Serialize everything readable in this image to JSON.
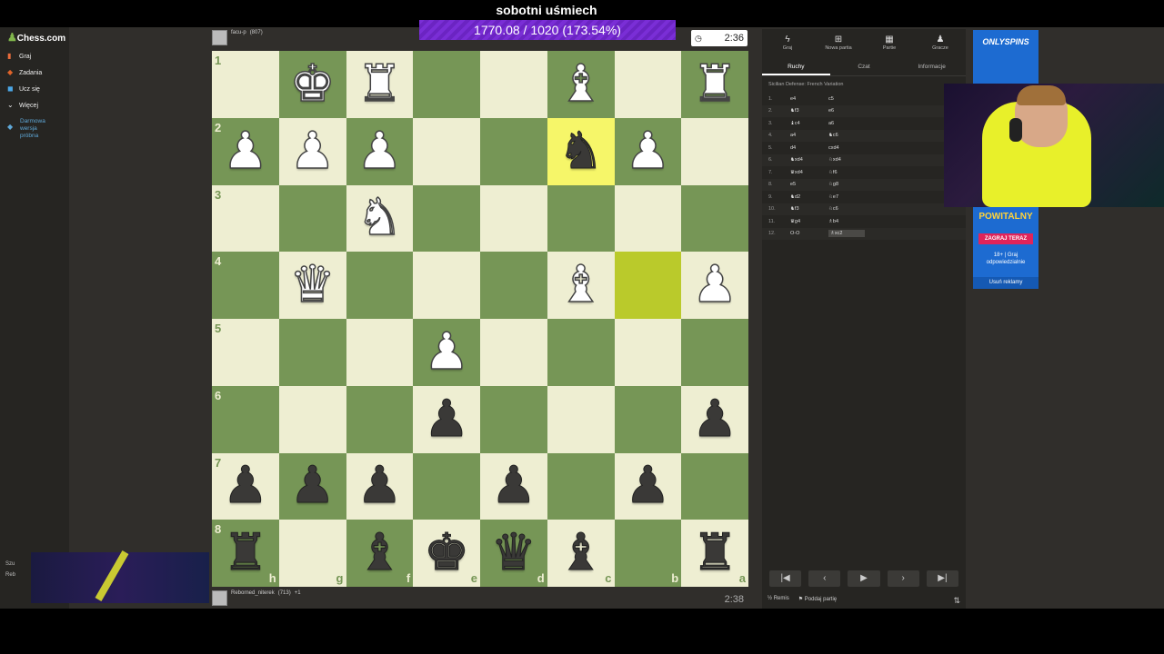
{
  "overlay": {
    "title": "sobotni uśmiech",
    "counter": "1770.08 / 1020 (173.54%)"
  },
  "sidebar": {
    "logo": "Chess.com",
    "items": [
      {
        "label": "Graj",
        "icon": "play-icon"
      },
      {
        "label": "Zadania",
        "icon": "puzzle-icon"
      },
      {
        "label": "Ucz się",
        "icon": "learn-icon"
      },
      {
        "label": "Więcej",
        "icon": "chevron-down-icon"
      }
    ],
    "promo": "Darmowa wersja próbna",
    "search_label": "Szu",
    "user_label": "Reb"
  },
  "top_player": {
    "name": "facu-p",
    "rating": "(807)",
    "clock": "2:36"
  },
  "bottom_player": {
    "name": "Reborned_niterek",
    "rating": "(713)",
    "material": "+1",
    "clock": "2:38"
  },
  "board": {
    "colors": {
      "light": "#eeeed2",
      "dark": "#769656",
      "highlight_light": "#f6f669",
      "highlight_dark": "#baca2b"
    },
    "ranks": [
      "1",
      "2",
      "3",
      "4",
      "5",
      "6",
      "7",
      "8"
    ],
    "files": [
      "h",
      "g",
      "f",
      "e",
      "d",
      "c",
      "b",
      "a"
    ],
    "rows": [
      [
        "",
        "wK",
        "wR",
        "",
        "",
        "wB",
        "",
        "wR"
      ],
      [
        "wP",
        "wP",
        "wP",
        "",
        "",
        "bN",
        "wP",
        ""
      ],
      [
        "",
        "",
        "wN",
        "",
        "",
        "",
        "",
        ""
      ],
      [
        "",
        "wQ",
        "",
        "",
        "",
        "wB",
        "",
        "wP"
      ],
      [
        "",
        "",
        "",
        "wP",
        "",
        "",
        "",
        ""
      ],
      [
        "",
        "",
        "",
        "bP",
        "",
        "",
        "",
        "bP"
      ],
      [
        "bP",
        "bP",
        "bP",
        "",
        "bP",
        "",
        "bP",
        ""
      ],
      [
        "bR",
        "",
        "bB",
        "bK",
        "bQ",
        "bB",
        "",
        "bR"
      ]
    ],
    "highlights": [
      [
        1,
        5
      ],
      [
        3,
        6
      ]
    ]
  },
  "panel": {
    "tabs": [
      {
        "label": "Graj",
        "icon": "lightning-icon"
      },
      {
        "label": "Nowa partia",
        "icon": "plus-icon"
      },
      {
        "label": "Partie",
        "icon": "grid-icon"
      },
      {
        "label": "Gracze",
        "icon": "people-icon"
      }
    ],
    "subtabs": [
      "Ruchy",
      "Czat",
      "Informacje"
    ],
    "opening": "Sicilian Defense: French Variation",
    "moves": [
      {
        "n": "1.",
        "w": "e4",
        "b": "c5"
      },
      {
        "n": "2.",
        "w": "♞f3",
        "b": "e6"
      },
      {
        "n": "3.",
        "w": "♝c4",
        "b": "a6"
      },
      {
        "n": "4.",
        "w": "a4",
        "b": "♞c6"
      },
      {
        "n": "5.",
        "w": "d4",
        "b": "cxd4"
      },
      {
        "n": "6.",
        "w": "♞xd4",
        "b": "♘xd4"
      },
      {
        "n": "7.",
        "w": "♛xd4",
        "b": "♘f6"
      },
      {
        "n": "8.",
        "w": "e5",
        "b": "♘g8"
      },
      {
        "n": "9.",
        "w": "♞d2",
        "b": "♘e7"
      },
      {
        "n": "10.",
        "w": "♞f3",
        "b": "♘c6"
      },
      {
        "n": "11.",
        "w": "♛g4",
        "b": "♗b4"
      },
      {
        "n": "12.",
        "w": "O-O",
        "b": "♗xc2"
      }
    ],
    "remis": "Remis",
    "resign": "Poddaj partię"
  },
  "ad": {
    "brand": "ONLYSPINS",
    "title": "POWITALNY",
    "cta": "ZAGRAJ TERAZ",
    "responsible": "18+ | Graj odpowiedzialnie",
    "remove": "Usuń reklamy"
  }
}
